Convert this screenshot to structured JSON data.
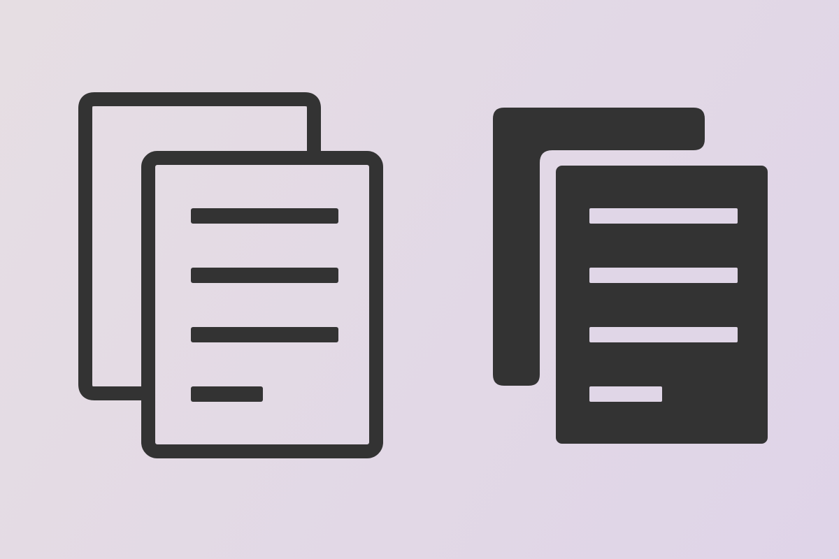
{
  "background": {
    "gradient_start": "#e6dee3",
    "gradient_end": "#dfd4e8"
  },
  "icon_color": "#333333",
  "icons": [
    {
      "name": "copy-outline-icon",
      "style": "outline"
    },
    {
      "name": "copy-filled-icon",
      "style": "filled"
    }
  ]
}
